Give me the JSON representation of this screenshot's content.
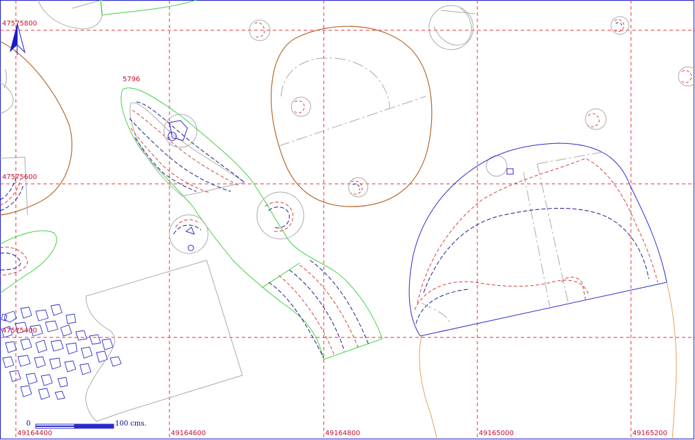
{
  "grid": {
    "x_labels": [
      "49164400",
      "49164600",
      "49164800",
      "49165000",
      "49165200"
    ],
    "y_labels": [
      "47575800",
      "47575600",
      "47575400"
    ]
  },
  "feature_label": "5796",
  "north_arrow": "north-arrow-icon",
  "scale_bar": {
    "zero_label": "0",
    "end_label": "100 cms."
  },
  "colors": {
    "grid": "#e0303a",
    "green_outline": "#40d040",
    "brown_outline": "#b3672a",
    "orange_outline": "#e0a060",
    "blue_outline": "#2a2acc",
    "gray_outline": "#aaaaaa",
    "dark_dash": "#1a1a8a",
    "red_dash": "#d04040"
  }
}
